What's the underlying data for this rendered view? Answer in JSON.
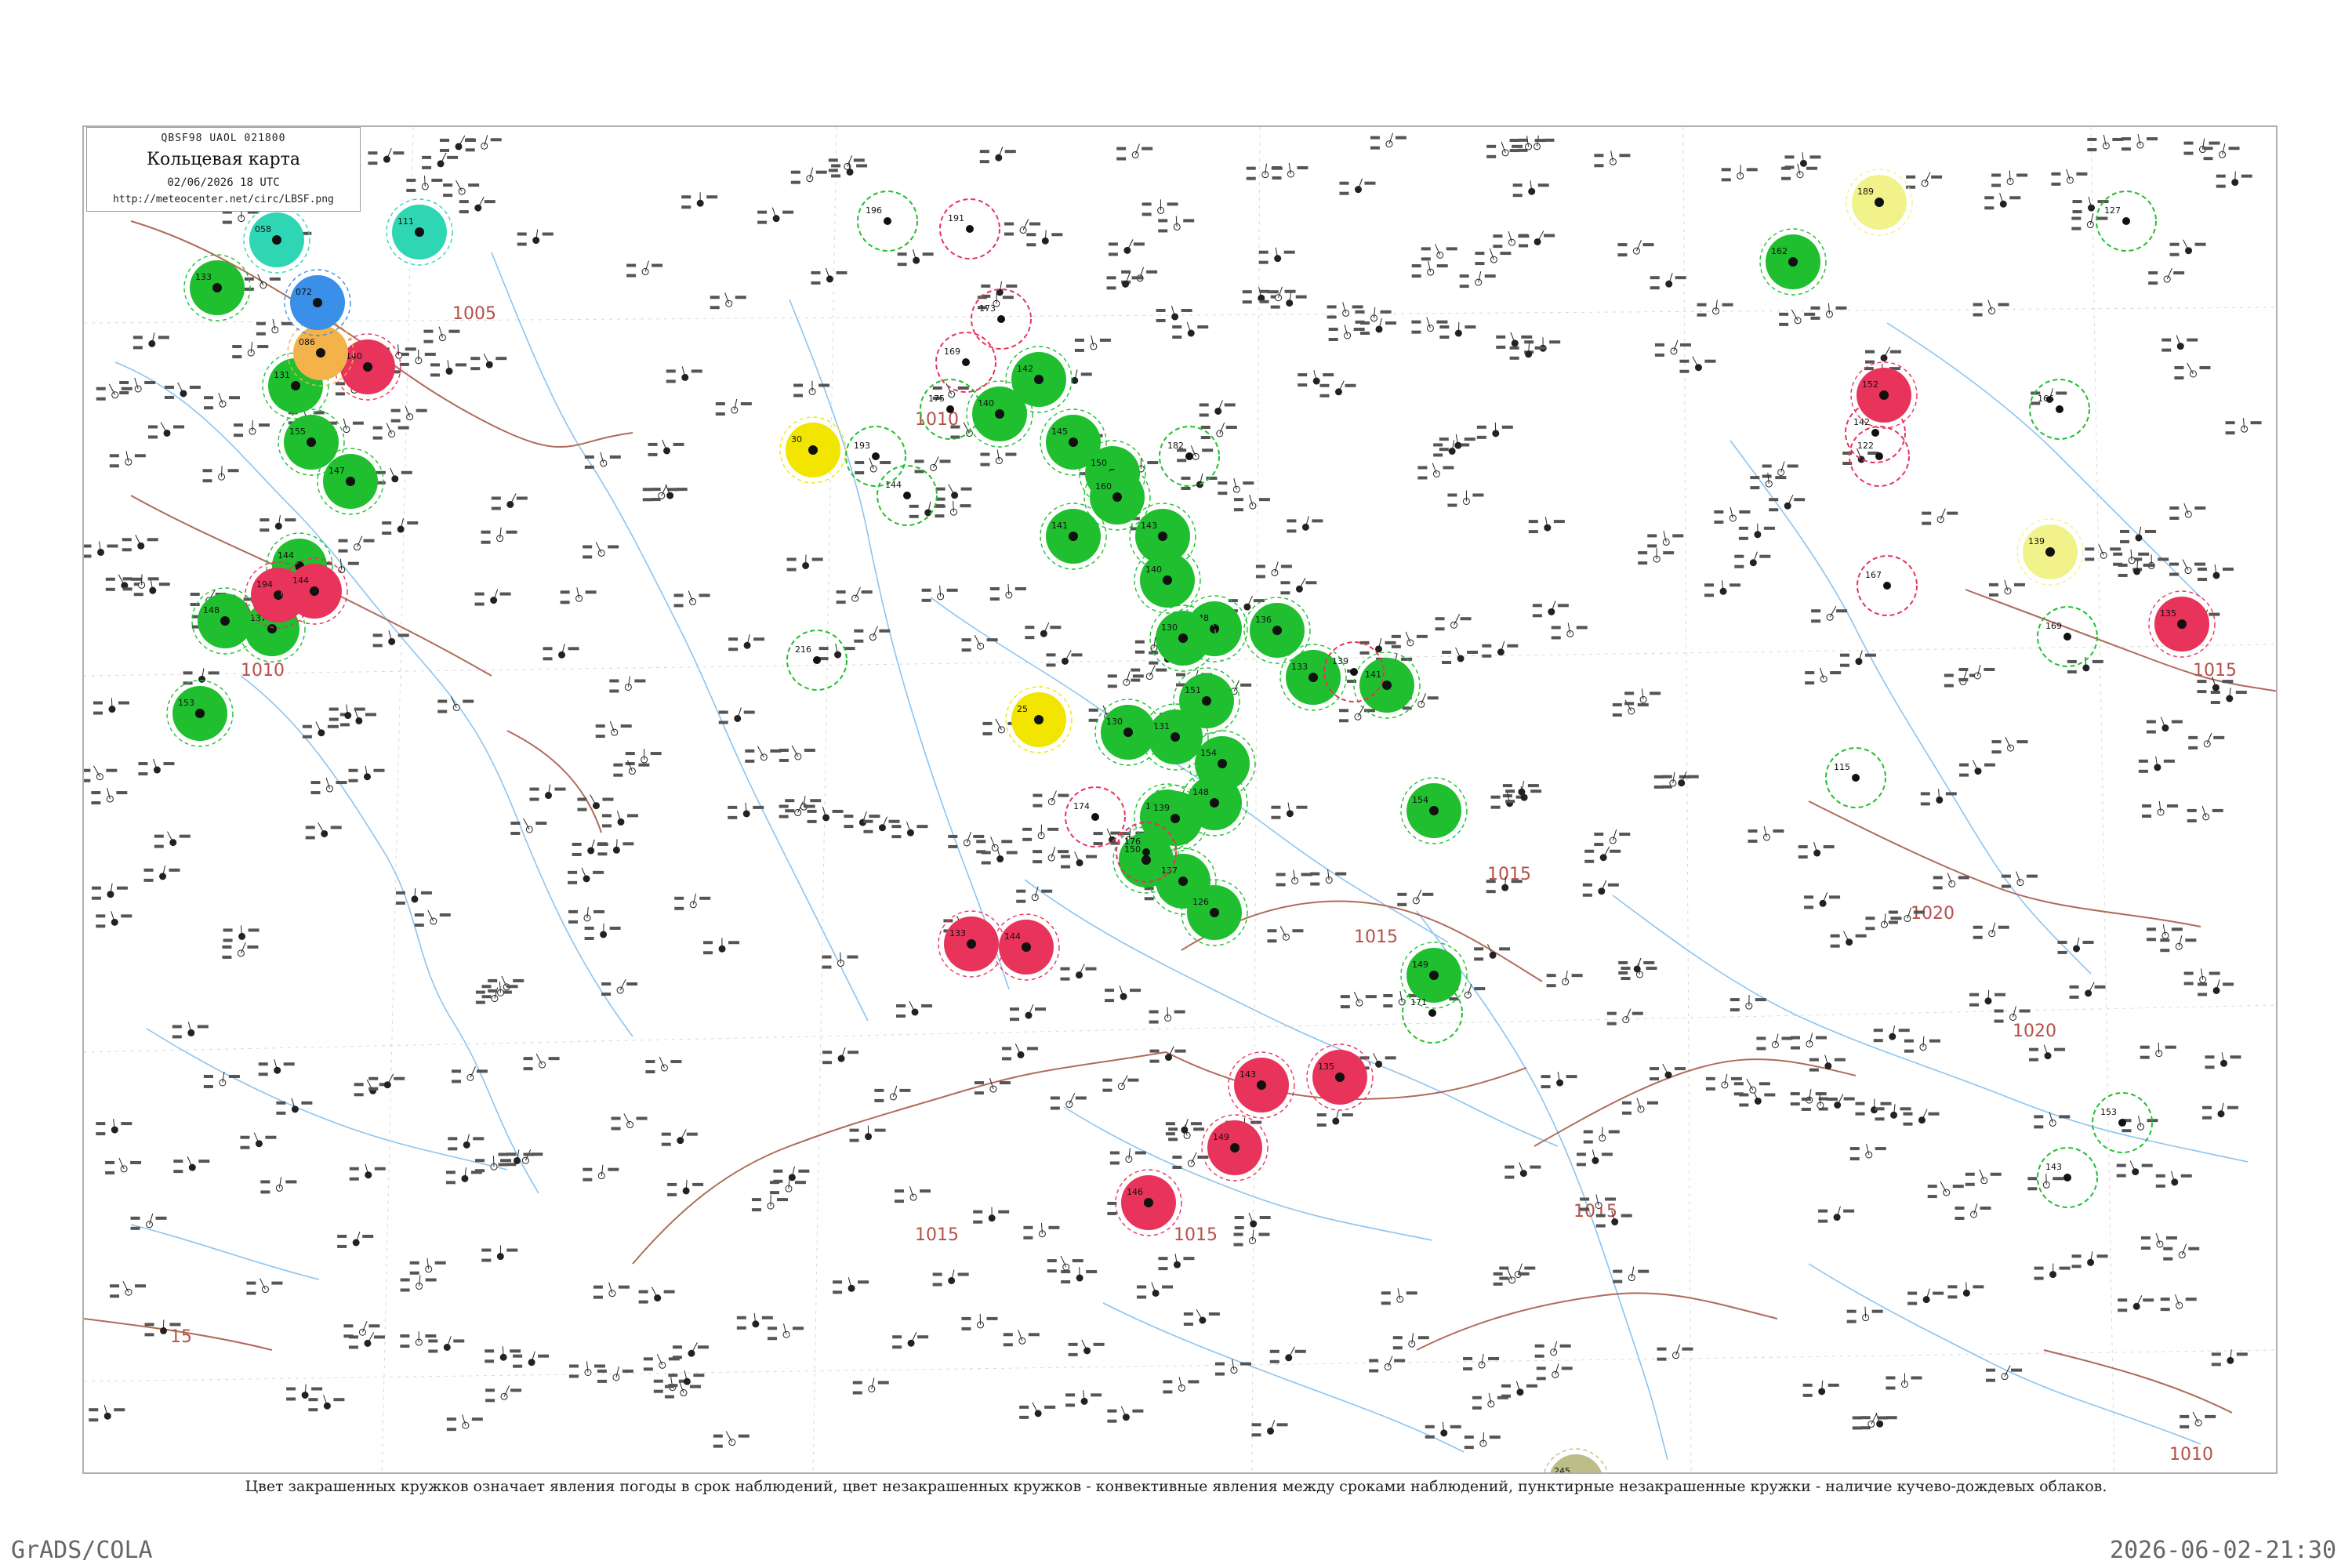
{
  "legend": {
    "header": "QBSF98 UAOL 021800",
    "title": "Кольцевая карта",
    "datetime": "02/06/2026 18 UTC",
    "url": "http://meteocenter.net/circ/LBSF.png"
  },
  "caption": "Цвет закрашенных кружков означает явления погоды в срок наблюдений, цвет незакрашенных кружков - конвективные явления между сроками наблюдений, пунктирные незакрашенные кружки - наличие кучево-дождевых облаков.",
  "footer": {
    "left": "GrADS/COLA",
    "right": "2026-06-02-21:30"
  },
  "colors": {
    "green": "#1fbf2f",
    "red": "#e8335a",
    "yellow": "#f2e600",
    "light_yellow": "#f2f28a",
    "orange": "#f4b24a",
    "blue": "#3a8fe8",
    "teal": "#2fd6b4",
    "olive": "#bdbd8a",
    "isobar": "#b06a5a",
    "river": "#8cc4f0"
  },
  "isobars": [
    {
      "label": "1005"
    },
    {
      "label": "1010"
    },
    {
      "label": "1010"
    },
    {
      "label": "1015"
    },
    {
      "label": "1015"
    },
    {
      "label": "1015"
    },
    {
      "label": "1015"
    },
    {
      "label": "1015"
    },
    {
      "label": "1015"
    },
    {
      "label": "1020"
    },
    {
      "label": "1020"
    },
    {
      "label": "1010"
    },
    {
      "label": "1010"
    },
    {
      "label": "15"
    }
  ],
  "stations": [
    {
      "type": "filled",
      "color": "green",
      "num": "133"
    },
    {
      "type": "filled",
      "color": "green",
      "num": "131"
    },
    {
      "type": "filled",
      "color": "green",
      "num": "155"
    },
    {
      "type": "filled",
      "color": "green",
      "num": "147"
    },
    {
      "type": "filled",
      "color": "green",
      "num": "144"
    },
    {
      "type": "filled",
      "color": "green",
      "num": "148"
    },
    {
      "type": "filled",
      "color": "green",
      "num": "137"
    },
    {
      "type": "filled",
      "color": "green",
      "num": "153"
    },
    {
      "type": "filled",
      "color": "green",
      "num": "140"
    },
    {
      "type": "filled",
      "color": "green",
      "num": "142"
    },
    {
      "type": "filled",
      "color": "green",
      "num": "145"
    },
    {
      "type": "filled",
      "color": "green",
      "num": "150"
    },
    {
      "type": "filled",
      "color": "green",
      "num": "141"
    },
    {
      "type": "filled",
      "color": "green",
      "num": "160"
    },
    {
      "type": "filled",
      "color": "green",
      "num": "143"
    },
    {
      "type": "filled",
      "color": "green",
      "num": "140"
    },
    {
      "type": "filled",
      "color": "green",
      "num": "148"
    },
    {
      "type": "filled",
      "color": "green",
      "num": "130"
    },
    {
      "type": "filled",
      "color": "green",
      "num": "151"
    },
    {
      "type": "filled",
      "color": "green",
      "num": "131"
    },
    {
      "type": "filled",
      "color": "green",
      "num": "130"
    },
    {
      "type": "filled",
      "color": "green",
      "num": "150"
    },
    {
      "type": "filled",
      "color": "green",
      "num": "154"
    },
    {
      "type": "filled",
      "color": "green",
      "num": "139"
    },
    {
      "type": "filled",
      "color": "green",
      "num": "148"
    },
    {
      "type": "filled",
      "color": "green",
      "num": "150"
    },
    {
      "type": "filled",
      "color": "green",
      "num": "137"
    },
    {
      "type": "filled",
      "color": "green",
      "num": "126"
    },
    {
      "type": "filled",
      "color": "green",
      "num": "136"
    },
    {
      "type": "filled",
      "color": "green",
      "num": "133"
    },
    {
      "type": "filled",
      "color": "green",
      "num": "141"
    },
    {
      "type": "filled",
      "color": "green",
      "num": "154"
    },
    {
      "type": "filled",
      "color": "green",
      "num": "149"
    },
    {
      "type": "filled",
      "color": "green",
      "num": "162"
    },
    {
      "type": "filled",
      "color": "red",
      "num": "140"
    },
    {
      "type": "filled",
      "color": "red",
      "num": "194"
    },
    {
      "type": "filled",
      "color": "red",
      "num": "144"
    },
    {
      "type": "filled",
      "color": "red",
      "num": "133"
    },
    {
      "type": "filled",
      "color": "red",
      "num": "144"
    },
    {
      "type": "filled",
      "color": "red",
      "num": "143"
    },
    {
      "type": "filled",
      "color": "red",
      "num": "135"
    },
    {
      "type": "filled",
      "color": "red",
      "num": "149"
    },
    {
      "type": "filled",
      "color": "red",
      "num": "146"
    },
    {
      "type": "filled",
      "color": "red",
      "num": "135"
    },
    {
      "type": "filled",
      "color": "red",
      "num": "152"
    },
    {
      "type": "filled",
      "color": "yellow",
      "num": "30"
    },
    {
      "type": "filled",
      "color": "yellow",
      "num": "25"
    },
    {
      "type": "filled",
      "color": "light_yellow",
      "num": "189"
    },
    {
      "type": "filled",
      "color": "light_yellow",
      "num": "139"
    },
    {
      "type": "filled",
      "color": "orange",
      "num": "086"
    },
    {
      "type": "filled",
      "color": "blue",
      "num": "072"
    },
    {
      "type": "filled",
      "color": "teal",
      "num": "058"
    },
    {
      "type": "filled",
      "color": "teal",
      "num": "111"
    },
    {
      "type": "filled",
      "color": "olive",
      "num": "245"
    },
    {
      "type": "ring",
      "color": "green",
      "num": "196"
    },
    {
      "type": "ring",
      "color": "green",
      "num": "175"
    },
    {
      "type": "ring",
      "color": "green",
      "num": "193"
    },
    {
      "type": "ring",
      "color": "green",
      "num": "144"
    },
    {
      "type": "ring",
      "color": "green",
      "num": "216"
    },
    {
      "type": "ring",
      "color": "green",
      "num": "182"
    },
    {
      "type": "ring",
      "color": "green",
      "num": "171"
    },
    {
      "type": "ring",
      "color": "green",
      "num": "127"
    },
    {
      "type": "ring",
      "color": "green",
      "num": "166"
    },
    {
      "type": "ring",
      "color": "green",
      "num": "115"
    },
    {
      "type": "ring",
      "color": "green",
      "num": "169"
    },
    {
      "type": "ring",
      "color": "green",
      "num": "153"
    },
    {
      "type": "ring",
      "color": "green",
      "num": "143"
    },
    {
      "type": "ring",
      "color": "red",
      "num": "191"
    },
    {
      "type": "ring",
      "color": "red",
      "num": "173"
    },
    {
      "type": "ring",
      "color": "red",
      "num": "169"
    },
    {
      "type": "ring",
      "color": "red",
      "num": "122"
    },
    {
      "type": "ring",
      "color": "red",
      "num": "167"
    },
    {
      "type": "ring",
      "color": "red",
      "num": "174"
    },
    {
      "type": "ring",
      "color": "red",
      "num": "176"
    },
    {
      "type": "ring",
      "color": "red",
      "num": "139"
    },
    {
      "type": "ring",
      "color": "red",
      "num": "142"
    }
  ]
}
